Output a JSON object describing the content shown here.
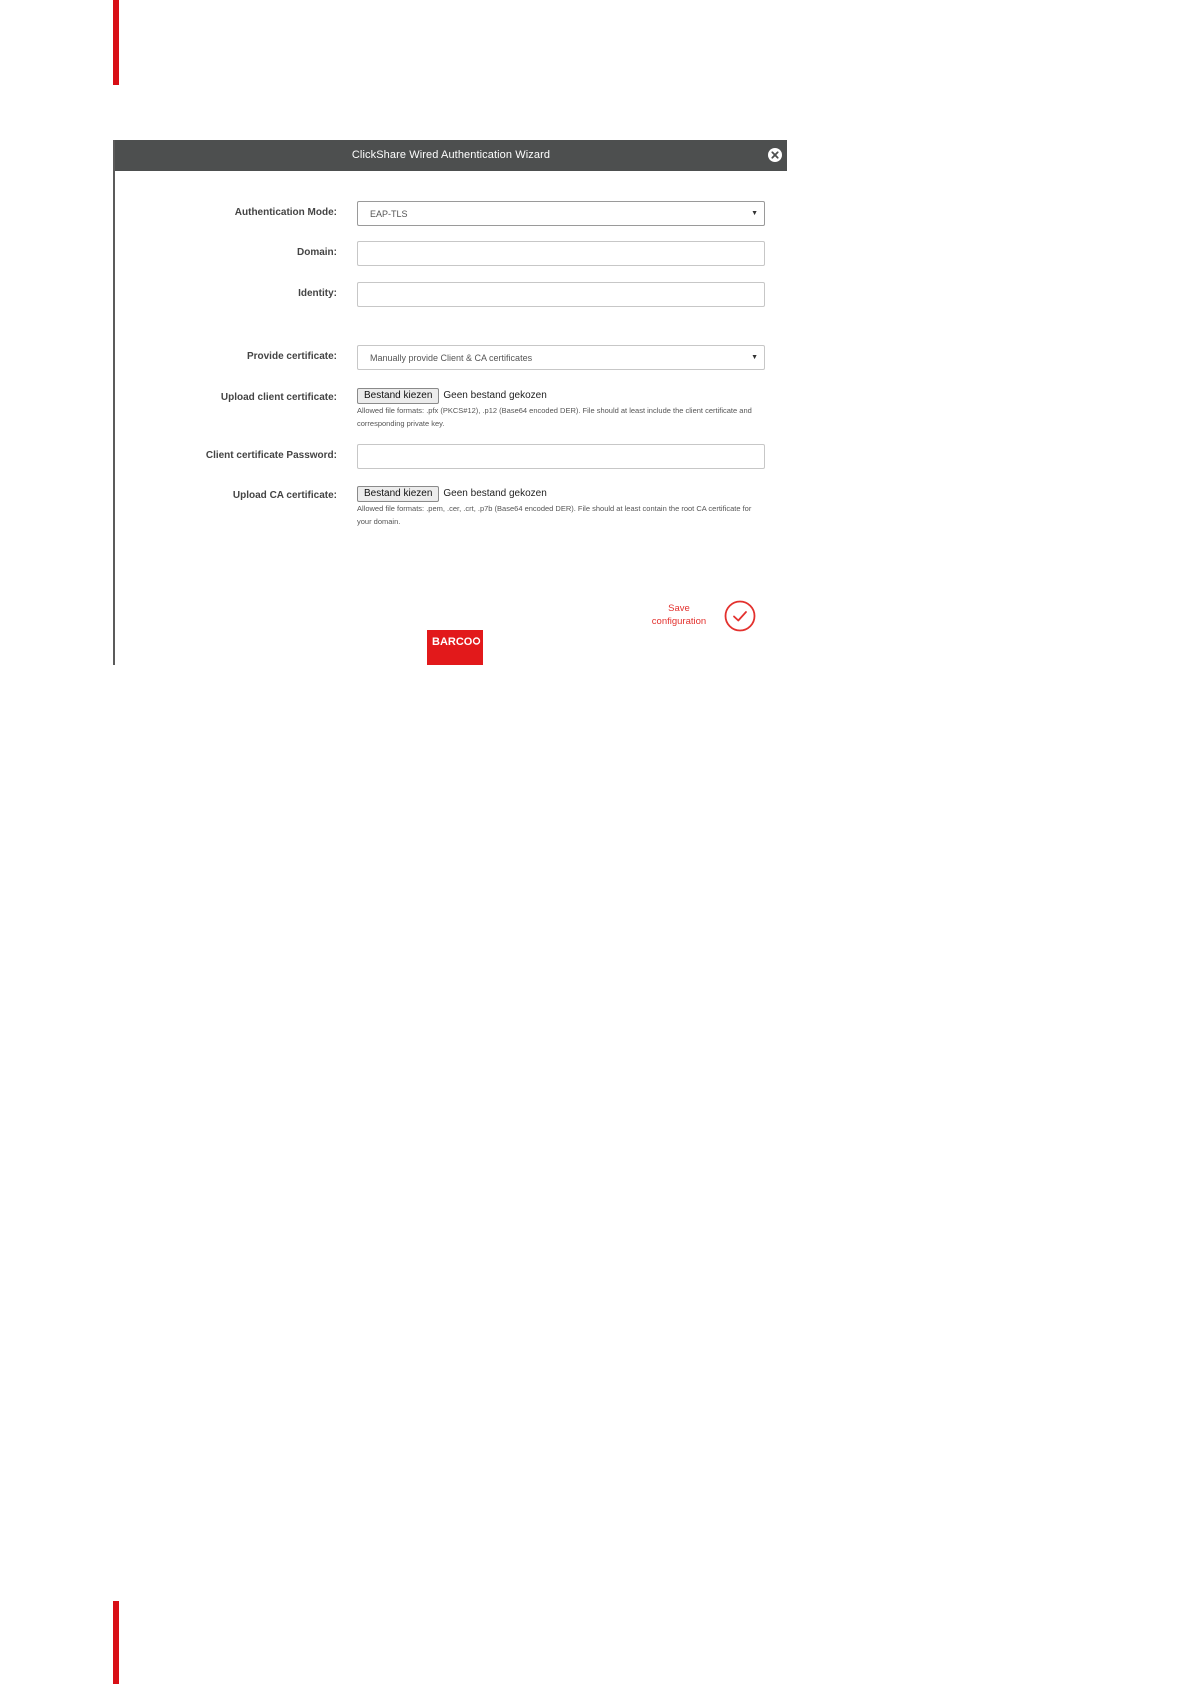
{
  "dialog": {
    "title": "ClickShare Wired Authentication Wizard",
    "close_icon": "close-circle-icon"
  },
  "form": {
    "auth_mode": {
      "label": "Authentication Mode:",
      "value": "EAP-TLS"
    },
    "domain": {
      "label": "Domain:",
      "value": ""
    },
    "identity": {
      "label": "Identity:",
      "value": ""
    },
    "provide_certificate": {
      "label": "Provide certificate:",
      "value": "Manually provide Client & CA certificates"
    },
    "client_cert": {
      "label": "Upload client certificate:",
      "button": "Bestand kiezen",
      "status": "Geen bestand gekozen",
      "hint": "Allowed file formats: .pfx (PKCS#12), .p12 (Base64 encoded DER). File should at least include the client certificate and corresponding private key."
    },
    "client_password": {
      "label": "Client certificate Password:",
      "value": ""
    },
    "ca_cert": {
      "label": "Upload CA certificate:",
      "button": "Bestand kiezen",
      "status": "Geen bestand gekozen",
      "hint": "Allowed file formats: .pem, .cer, .crt, .p7b (Base64 encoded DER). File should at least contain the root CA certificate for your domain."
    }
  },
  "actions": {
    "save_line1": "Save",
    "save_line2": "configuration",
    "save_icon": "check-circle-icon"
  },
  "brand": {
    "logo_text": "BARCO"
  },
  "colors": {
    "accent": "#e3312e",
    "titlebar": "#4d4f4f",
    "logo": "#e2191b"
  }
}
